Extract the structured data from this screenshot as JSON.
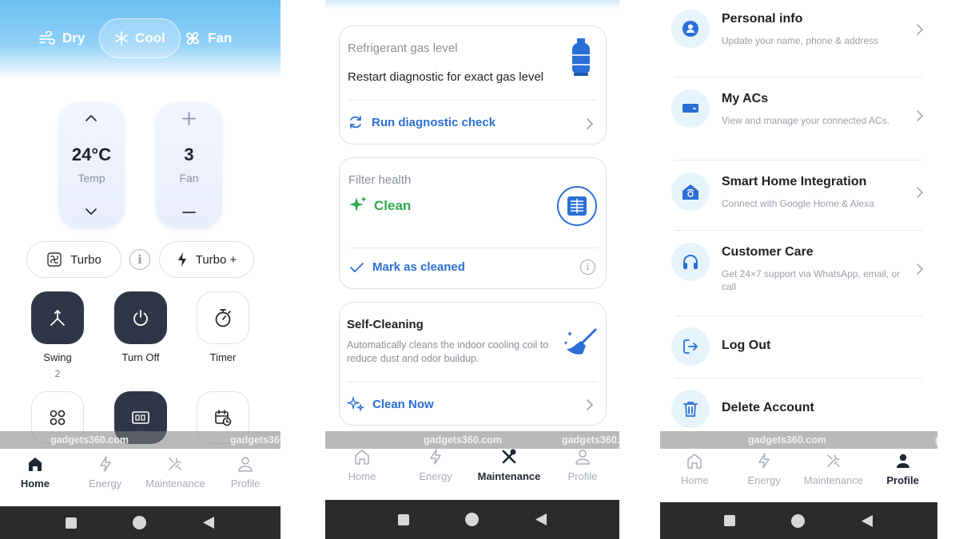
{
  "home": {
    "modes": [
      {
        "label": "Dry",
        "icon": "wind-icon"
      },
      {
        "label": "Cool",
        "icon": "snowflake-icon",
        "active": true
      },
      {
        "label": "Fan",
        "icon": "fan-icon"
      }
    ],
    "temp": {
      "value": "24°C",
      "label": "Temp"
    },
    "fan": {
      "value": "3",
      "label": "Fan"
    },
    "turbo_label": "Turbo",
    "turbo_plus_label": "Turbo +",
    "swing": {
      "label": "Swing",
      "value": "2"
    },
    "turn_off_label": "Turn Off",
    "timer_label": "Timer"
  },
  "maintenance": {
    "refrigerant": {
      "title": "Refrigerant gas level",
      "message": "Restart diagnostic for exact gas level",
      "action": "Run diagnostic check"
    },
    "filter": {
      "title": "Filter health",
      "status": "Clean",
      "action": "Mark as cleaned"
    },
    "self_cleaning": {
      "title": "Self-Cleaning",
      "description": "Automatically cleans the indoor cooling coil to reduce dust and odor buildup.",
      "action": "Clean Now"
    }
  },
  "profile": {
    "items": [
      {
        "title": "Personal info",
        "subtitle": "Update your name, phone & address"
      },
      {
        "title": "My ACs",
        "subtitle": "View and manage your connected ACs."
      },
      {
        "title": "Smart Home Integration",
        "subtitle": "Connect with Google Home & Alexa"
      },
      {
        "title": "Customer Care",
        "subtitle": "Get 24×7 support via WhatsApp, email, or call"
      },
      {
        "title": "Log Out"
      },
      {
        "title": "Delete Account"
      }
    ]
  },
  "nav": {
    "home": "Home",
    "energy": "Energy",
    "maintenance": "Maintenance",
    "profile": "Profile"
  },
  "watermark": "gadgets360.com",
  "watermark_partial": "gadg",
  "colors": {
    "accent_blue": "#2a6fd6",
    "clean_green": "#2fa84f",
    "dark_button": "#2e3647",
    "sky_gradient": "#6cc0f3"
  }
}
